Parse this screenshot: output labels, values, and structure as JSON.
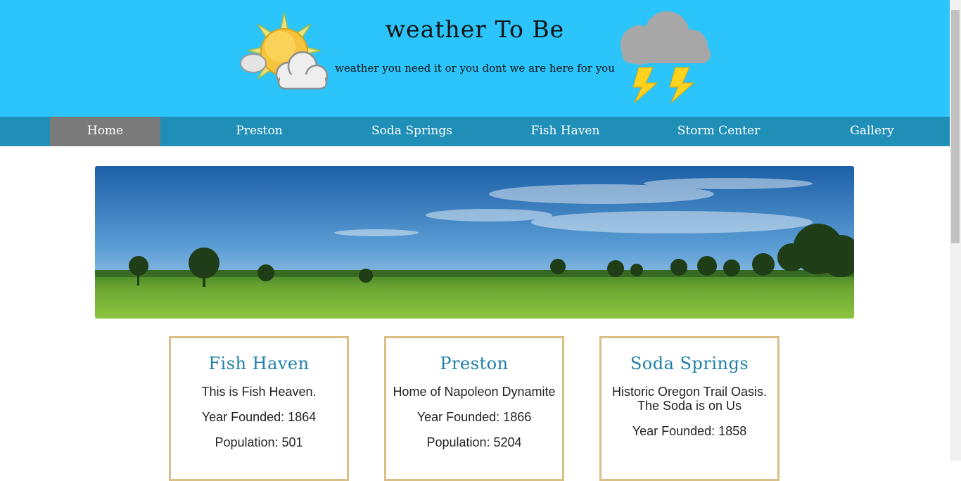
{
  "header": {
    "title": "weather To Be",
    "tagline": "weather you need it or you dont we are here for you"
  },
  "nav": {
    "items": [
      {
        "label": "Home",
        "active": true
      },
      {
        "label": "Preston",
        "active": false
      },
      {
        "label": "Soda Springs",
        "active": false
      },
      {
        "label": "Fish Haven",
        "active": false
      },
      {
        "label": "Storm Center",
        "active": false
      },
      {
        "label": "Gallery",
        "active": false
      }
    ]
  },
  "cards": [
    {
      "title": "Fish Haven",
      "line1": "This is Fish Heaven.",
      "founded": "Year Founded: 1864",
      "population": "Population: 501"
    },
    {
      "title": "Preston",
      "line1": "Home of Napoleon Dynamite",
      "founded": "Year Founded: 1866",
      "population": "Population: 5204"
    },
    {
      "title": "Soda Springs",
      "line1": "Historic Oregon Trail Oasis. The Soda is on Us",
      "founded": "Year Founded: 1858",
      "population": ""
    }
  ],
  "colors": {
    "header_bg": "#2bc4fb",
    "nav_bg": "#208fb8",
    "nav_active": "#7a7a7a",
    "card_border": "#d9bf86",
    "card_title": "#1f7fa8"
  },
  "icons": {
    "header_left": "sun-cloud-icon",
    "header_right": "storm-cloud-icon"
  }
}
